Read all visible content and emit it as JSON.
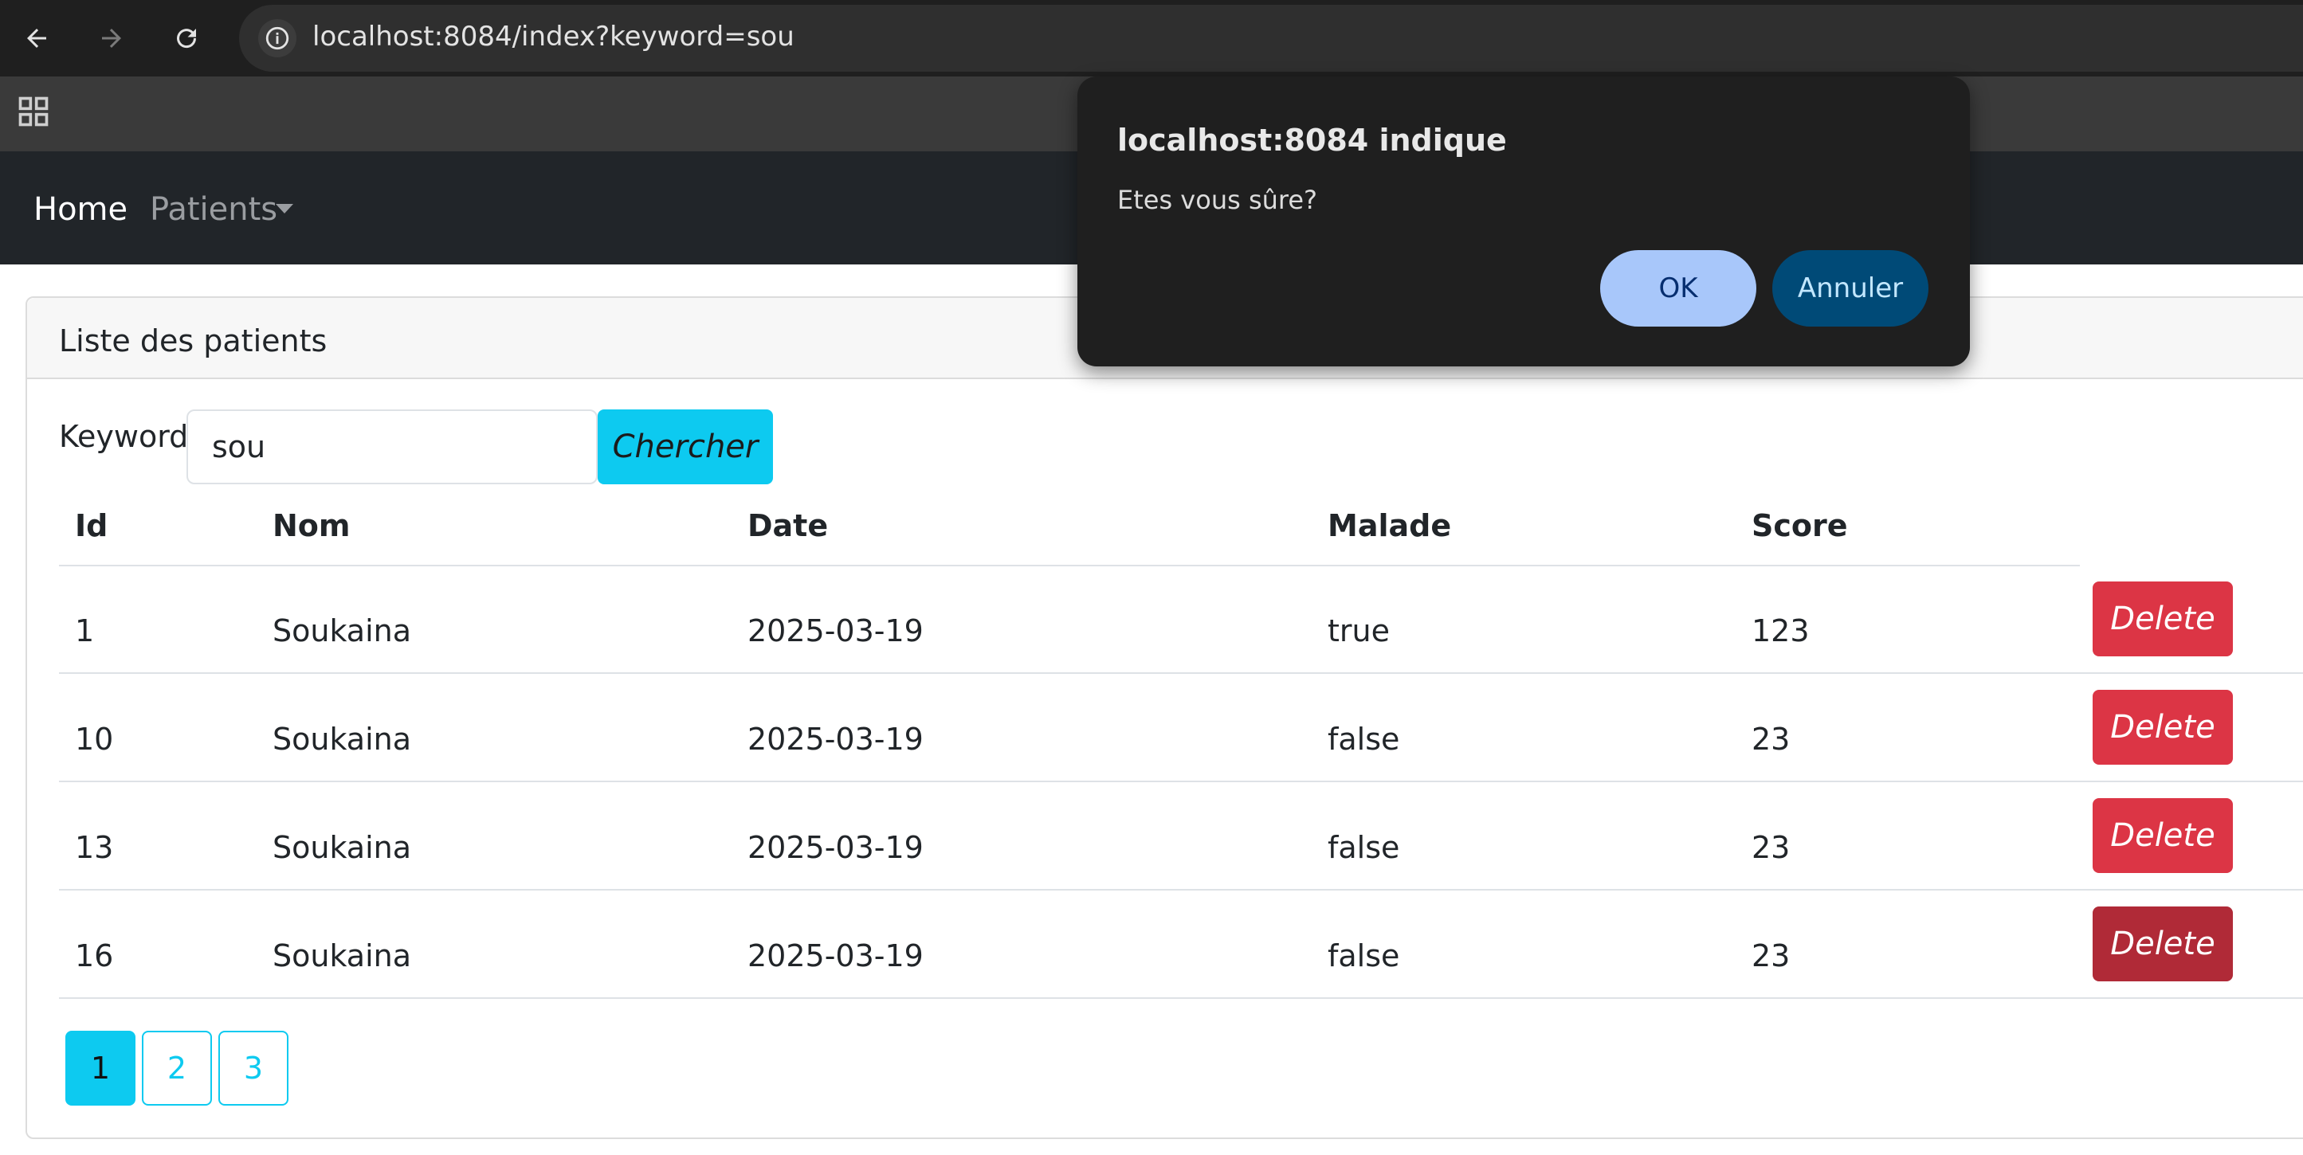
{
  "browser": {
    "url": "localhost:8084/index?keyword=sou"
  },
  "navbar": {
    "home_label": "Home",
    "patients_label": "Patients"
  },
  "card": {
    "title": "Liste des patients"
  },
  "search": {
    "label": "Keyword:",
    "value": "sou",
    "button_label": "Chercher"
  },
  "table": {
    "columns": [
      "Id",
      "Nom",
      "Date",
      "Malade",
      "Score"
    ],
    "rows": [
      {
        "id": "1",
        "nom": "Soukaina",
        "date": "2025-03-19",
        "malade": "true",
        "score": "123",
        "action": "Delete"
      },
      {
        "id": "10",
        "nom": "Soukaina",
        "date": "2025-03-19",
        "malade": "false",
        "score": "23",
        "action": "Delete"
      },
      {
        "id": "13",
        "nom": "Soukaina",
        "date": "2025-03-19",
        "malade": "false",
        "score": "23",
        "action": "Delete"
      },
      {
        "id": "16",
        "nom": "Soukaina",
        "date": "2025-03-19",
        "malade": "false",
        "score": "23",
        "action": "Delete"
      }
    ]
  },
  "pagination": {
    "pages": [
      "1",
      "2",
      "3"
    ],
    "active": "1"
  },
  "dialog": {
    "title": "localhost:8084 indique",
    "message": "Etes vous sûre?",
    "ok_label": "OK",
    "cancel_label": "Annuler"
  },
  "colors": {
    "info": "#0dcaf0",
    "danger": "#dc3545",
    "navbar": "#212529",
    "dialog_ok": "#a8c7fa",
    "dialog_cancel": "#004a77"
  },
  "icons": [
    "back-arrow-icon",
    "forward-arrow-icon",
    "reload-icon",
    "site-info-icon",
    "apps-grid-icon",
    "dropdown-caret-icon"
  ]
}
